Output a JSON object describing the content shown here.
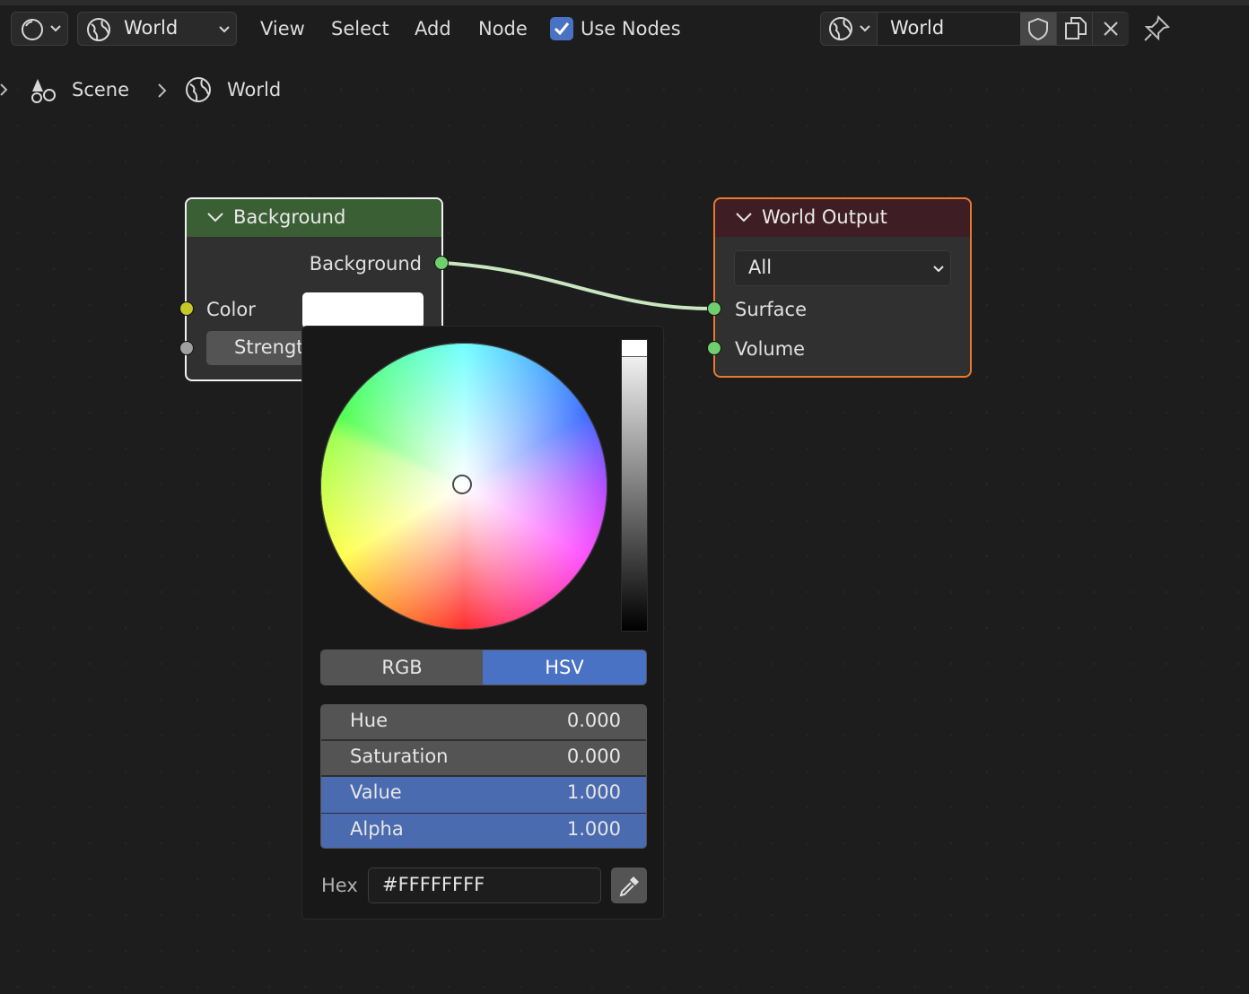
{
  "header": {
    "datablock_name": "World",
    "menus": [
      "View",
      "Select",
      "Add",
      "Node"
    ],
    "use_nodes_label": "Use Nodes",
    "use_nodes_checked": true,
    "world_field_value": "World"
  },
  "breadcrumb": {
    "items": [
      "Scene",
      "World"
    ]
  },
  "background_node": {
    "title": "Background",
    "output_label": "Background",
    "color_label": "Color",
    "strength_label": "Strengt"
  },
  "world_output_node": {
    "title": "World Output",
    "target_value": "All",
    "surface_label": "Surface",
    "volume_label": "Volume"
  },
  "color_picker": {
    "modes": [
      "RGB",
      "HSV"
    ],
    "active_mode": "HSV",
    "fields": [
      {
        "label": "Hue",
        "value": "0.000"
      },
      {
        "label": "Saturation",
        "value": "0.000"
      },
      {
        "label": "Value",
        "value": "1.000"
      },
      {
        "label": "Alpha",
        "value": "1.000"
      }
    ],
    "hex_label": "Hex",
    "hex_value": "#FFFFFFFF"
  },
  "colors": {
    "accent_blue": "#4a72c4",
    "background_node_header": "#3b5f34",
    "world_output_header": "#3f1d24",
    "selected_border": "#e8782d",
    "socket_shader": "#6fcf6f",
    "socket_color": "#c7c729",
    "socket_float": "#a0a0a0"
  }
}
